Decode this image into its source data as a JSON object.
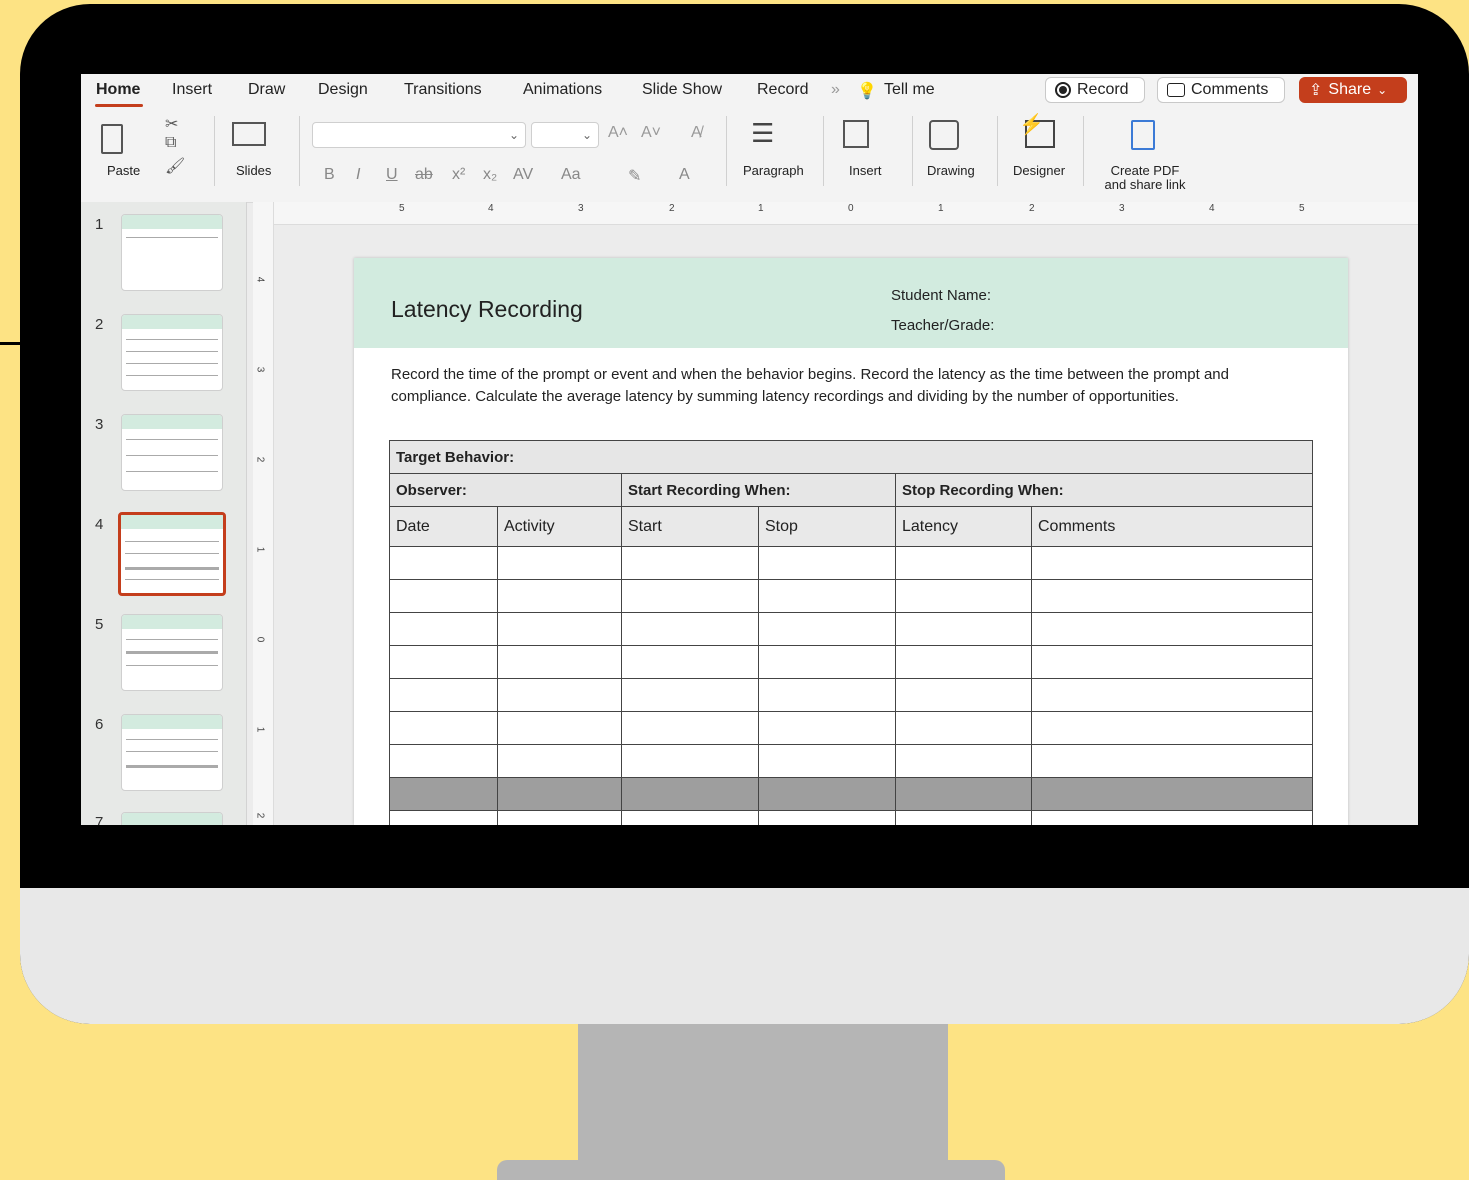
{
  "ribbon": {
    "tabs": [
      "Home",
      "Insert",
      "Draw",
      "Design",
      "Transitions",
      "Animations",
      "Slide Show",
      "Record"
    ],
    "active_tab": "Home",
    "tell_me": "Tell me",
    "record_button": "Record",
    "comments_button": "Comments",
    "share_button": "Share"
  },
  "toolbar": {
    "paste": "Paste",
    "slides": "Slides",
    "paragraph": "Paragraph",
    "insert": "Insert",
    "drawing": "Drawing",
    "designer": "Designer",
    "create_pdf_line1": "Create PDF",
    "create_pdf_line2": "and share link",
    "font_buttons": [
      "B",
      "I",
      "U",
      "ab",
      "x²",
      "x₂",
      "AV",
      "Aa",
      "A"
    ]
  },
  "thumbnails": {
    "numbers": [
      "1",
      "2",
      "3",
      "4",
      "5",
      "6",
      "7"
    ],
    "selected": "4"
  },
  "rulers": {
    "horizontal": [
      "5",
      "4",
      "3",
      "2",
      "1",
      "0",
      "1",
      "2",
      "3",
      "4",
      "5"
    ],
    "vertical": [
      "4",
      "3",
      "2",
      "1",
      "0",
      "1",
      "2"
    ]
  },
  "slide": {
    "title": "Latency Recording",
    "student_label": "Student Name:",
    "teacher_label": "Teacher/Grade:",
    "instructions": "Record the time of the prompt or event and when the behavior begins. Record the latency as the time between the prompt and compliance. Calculate the average latency by summing latency recordings and dividing by the number of opportunities.",
    "table": {
      "target_behavior": "Target Behavior:",
      "observer": "Observer:",
      "start_when": "Start Recording When:",
      "stop_when": "Stop Recording When:",
      "columns": [
        "Date",
        "Activity",
        "Start",
        "Stop",
        "Latency",
        "Comments"
      ]
    }
  },
  "colors": {
    "background": "#fde384",
    "accent": "#c43e1c",
    "slide_header": "#d2ebdf"
  }
}
